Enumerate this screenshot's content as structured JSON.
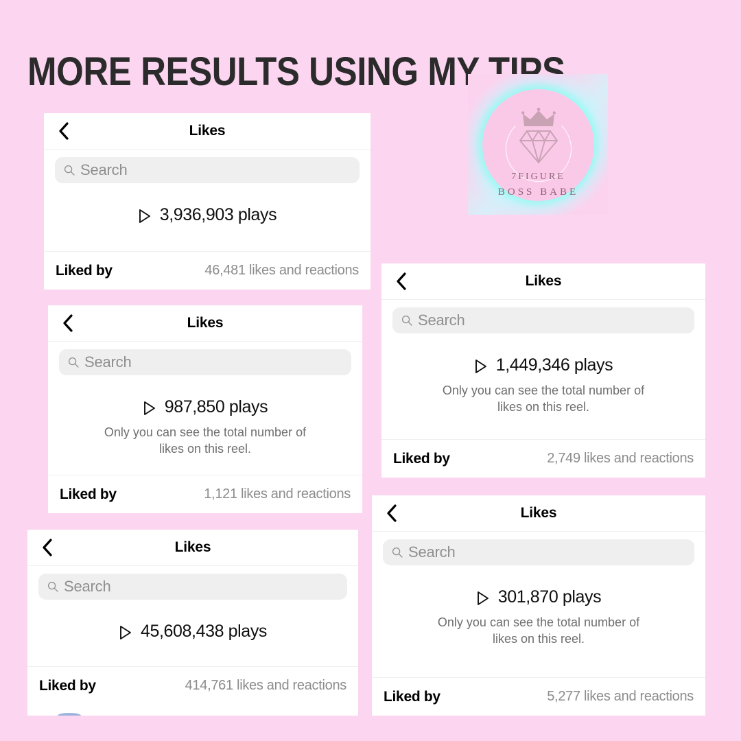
{
  "background_color": "#FCD6F0",
  "headline": "MORE RESULTS USING MY TIPS",
  "logo": {
    "line1": "7FIGURE",
    "line2": "BOSS BABE",
    "crown_icon": "crown-icon",
    "diamond_icon": "diamond-icon",
    "circle_color": "#FBC9E8",
    "glow_color": "#8CFCF0",
    "mark_color": "#C9A3B4",
    "text_color": "#8D6374"
  },
  "common": {
    "title": "Likes",
    "back_icon": "back-chevron-icon",
    "search_placeholder": "Search",
    "search_icon": "search-icon",
    "play_icon": "play-triangle-icon",
    "liked_by_label": "Liked by",
    "only_you_note": "Only you can see the total number of likes on this reel."
  },
  "cards": [
    {
      "id": "card-1",
      "title": "Likes",
      "search_placeholder": "Search",
      "plays": "3,936,903 plays",
      "note": "",
      "liked_by_label": "Liked by",
      "likes": "46,481 likes and reactions"
    },
    {
      "id": "card-2",
      "title": "Likes",
      "search_placeholder": "Search",
      "plays": "987,850 plays",
      "note": "Only you can see the total number of likes on this reel.",
      "liked_by_label": "Liked by",
      "likes": "1,121 likes and reactions"
    },
    {
      "id": "card-3",
      "title": "Likes",
      "search_placeholder": "Search",
      "plays": "45,608,438 plays",
      "note": "",
      "liked_by_label": "Liked by",
      "likes": "414,761 likes and reactions"
    },
    {
      "id": "card-4",
      "title": "Likes",
      "search_placeholder": "Search",
      "plays": "1,449,346 plays",
      "note": "Only you can see the total number of likes on this reel.",
      "liked_by_label": "Liked by",
      "likes": "2,749 likes and reactions"
    },
    {
      "id": "card-5",
      "title": "Likes",
      "search_placeholder": "Search",
      "plays": "301,870 plays",
      "note": "Only you can see the total number of likes on this reel.",
      "liked_by_label": "Liked by",
      "likes": "5,277 likes and reactions"
    }
  ]
}
